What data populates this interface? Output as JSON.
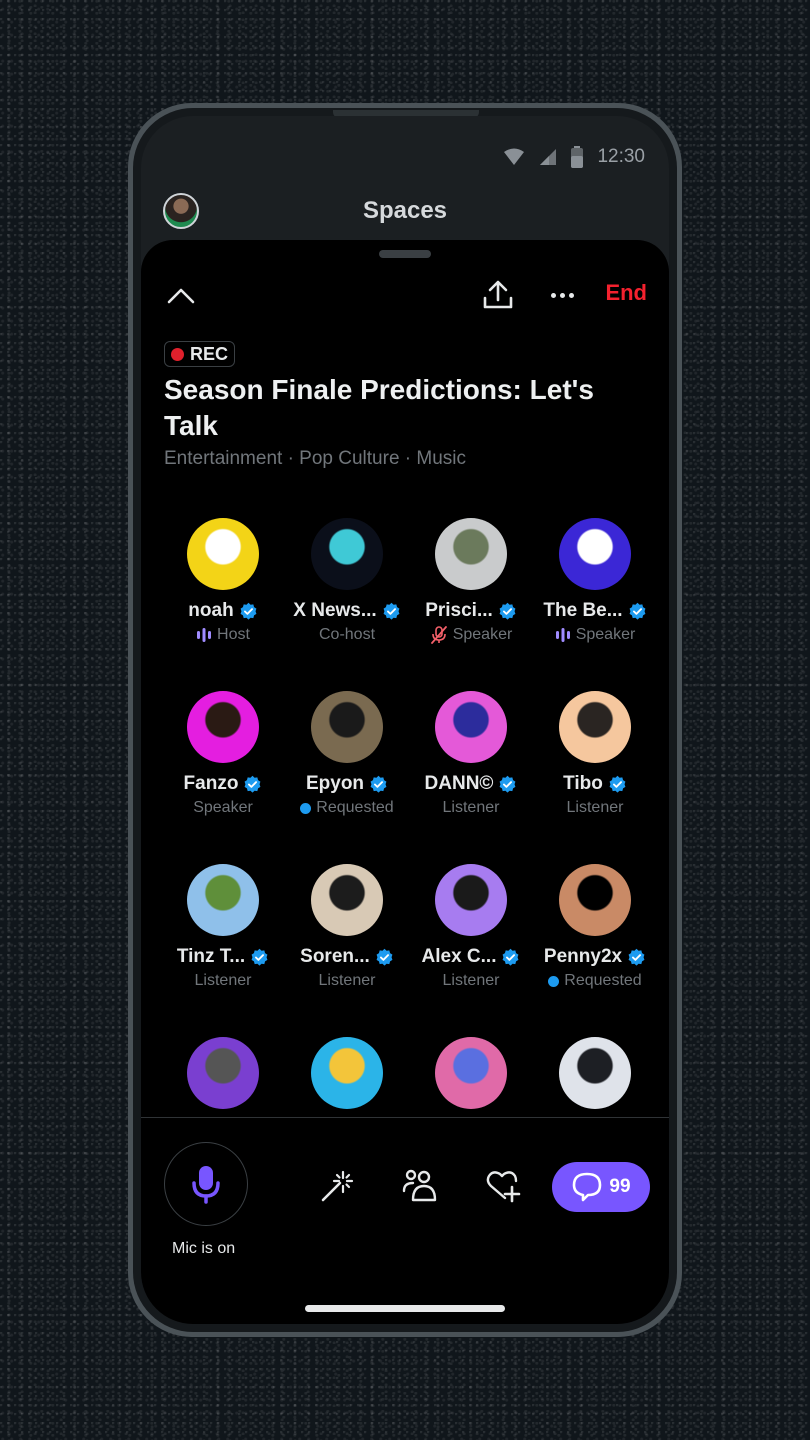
{
  "status_bar": {
    "time": "12:30",
    "icons": [
      "wifi-icon",
      "cellular-signal-icon",
      "battery-icon"
    ]
  },
  "header": {
    "title": "Spaces",
    "profile_avatar": "profile-avatar"
  },
  "space": {
    "actions": {
      "collapse_icon": "chevron-up-icon",
      "share_icon": "share-icon",
      "more_icon": "more-horizontal-icon",
      "end_label": "End"
    },
    "recording_badge": "REC",
    "title": "Season Finale Predictions: Let's Talk",
    "topics": "Entertainment · Pop Culture · Music",
    "colors": {
      "accent": "#7856ff",
      "end": "#f4212e",
      "verified": "#1d9bf0",
      "muted_red": "#f4212e",
      "speaking_purple": "#a08cff"
    }
  },
  "participants": [
    {
      "name": "noah",
      "role": "Host",
      "role_icon": "speaking-bars-icon",
      "verified": true,
      "avatar_colors": [
        "#f3d417",
        "#ffffff"
      ]
    },
    {
      "name": "X News...",
      "role": "Co-host",
      "role_icon": "",
      "verified": true,
      "avatar_colors": [
        "#0b0f1a",
        "#3fc9d6"
      ]
    },
    {
      "name": "Prisci...",
      "role": "Speaker",
      "role_icon": "mic-muted-icon",
      "verified": true,
      "avatar_colors": [
        "#c9cbcc",
        "#6b7a5c"
      ]
    },
    {
      "name": "The Be...",
      "role": "Speaker",
      "role_icon": "speaking-bars-icon",
      "verified": true,
      "avatar_colors": [
        "#3b27d6",
        "#ffffff"
      ]
    },
    {
      "name": "Fanzo",
      "role": "Speaker",
      "role_icon": "",
      "verified": true,
      "avatar_colors": [
        "#e41ee0",
        "#2a1a14"
      ]
    },
    {
      "name": "Epyon",
      "role": "Requested",
      "role_icon": "requested-dot-icon",
      "verified": true,
      "avatar_colors": [
        "#7a6a50",
        "#1a1a1a"
      ]
    },
    {
      "name": "DANN©",
      "role": "Listener",
      "role_icon": "",
      "verified": true,
      "avatar_colors": [
        "#e459d8",
        "#2c2c9c"
      ]
    },
    {
      "name": "Tibo",
      "role": "Listener",
      "role_icon": "",
      "verified": true,
      "avatar_colors": [
        "#f5c79e",
        "#2a2522"
      ]
    },
    {
      "name": "Tinz T...",
      "role": "Listener",
      "role_icon": "",
      "verified": true,
      "avatar_colors": [
        "#8fc0ea",
        "#5f8f3a"
      ]
    },
    {
      "name": "Soren...",
      "role": "Listener",
      "role_icon": "",
      "verified": true,
      "avatar_colors": [
        "#d8c9b5",
        "#1c1c1c"
      ]
    },
    {
      "name": "Alex C...",
      "role": "Listener",
      "role_icon": "",
      "verified": true,
      "avatar_colors": [
        "#a77cf0",
        "#1a1a1a"
      ]
    },
    {
      "name": "Penny2x",
      "role": "Requested",
      "role_icon": "requested-dot-icon",
      "verified": true,
      "avatar_colors": [
        "#c98a66",
        "#000000"
      ]
    },
    {
      "name": "",
      "role": "",
      "role_icon": "",
      "verified": false,
      "avatar_colors": [
        "#7a3fd0",
        "#555555"
      ]
    },
    {
      "name": "",
      "role": "",
      "role_icon": "",
      "verified": false,
      "avatar_colors": [
        "#2bb4e8",
        "#f3c53a"
      ]
    },
    {
      "name": "",
      "role": "",
      "role_icon": "",
      "verified": false,
      "avatar_colors": [
        "#e06aa8",
        "#5a6fe0"
      ]
    },
    {
      "name": "",
      "role": "",
      "role_icon": "",
      "verified": false,
      "avatar_colors": [
        "#dfe3ea",
        "#1d1f24"
      ]
    }
  ],
  "controls": {
    "mic_label": "Mic is on",
    "tools": [
      "magic-wand-icon",
      "people-icon",
      "heart-plus-icon"
    ],
    "chat_count": "99"
  }
}
